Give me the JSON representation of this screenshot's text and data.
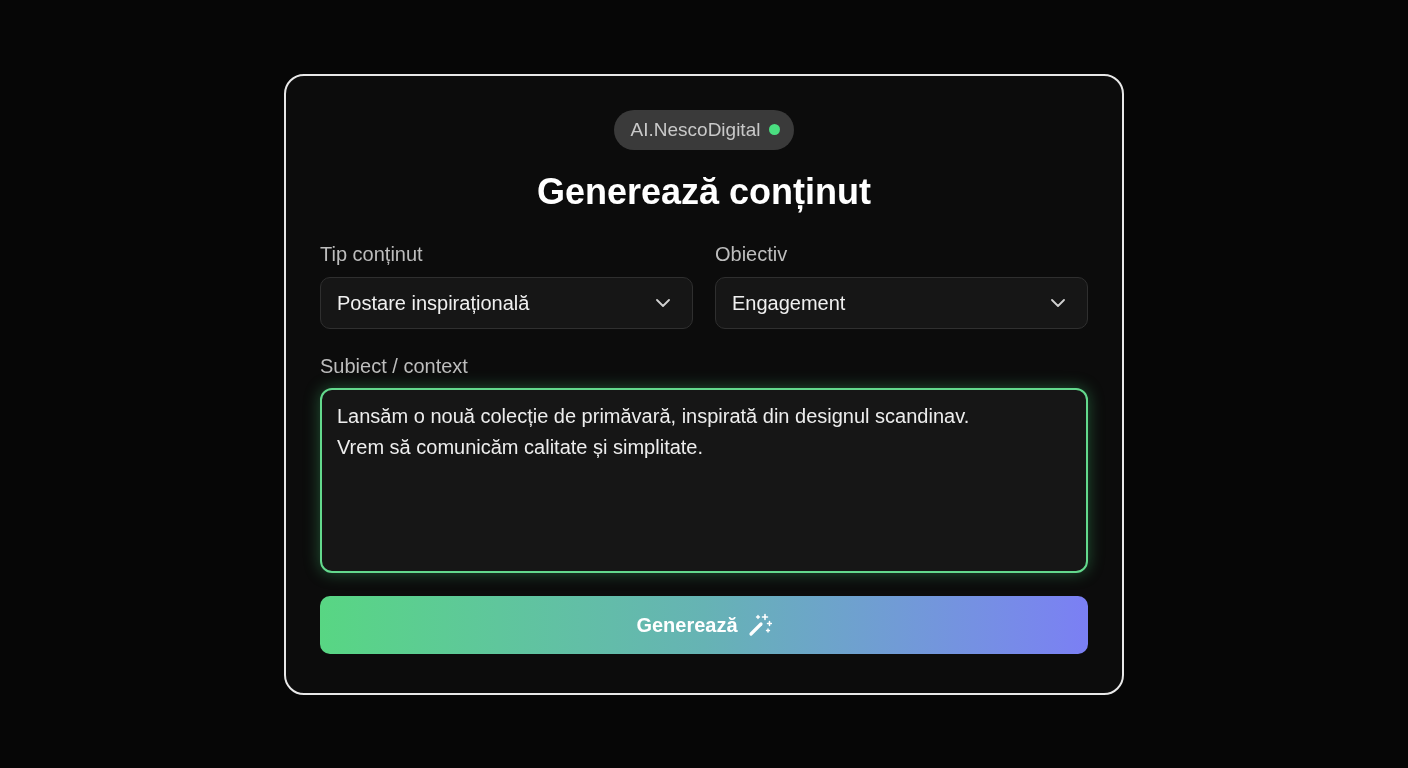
{
  "badge": {
    "label": "AI.NescoDigital",
    "online": true
  },
  "title": "Generează conținut",
  "selects": [
    {
      "label": "Tip conținut",
      "value": "Postare inspirațională"
    },
    {
      "label": "Obiectiv",
      "value": "Engagement"
    }
  ],
  "context": {
    "label": "Subiect / context",
    "value": "Lansăm o nouă colecție de primăvară, inspirată din designul scandinav.\nVrem să comunicăm calitate și simplitate.",
    "focused": true
  },
  "button": {
    "label": "Generează"
  }
}
